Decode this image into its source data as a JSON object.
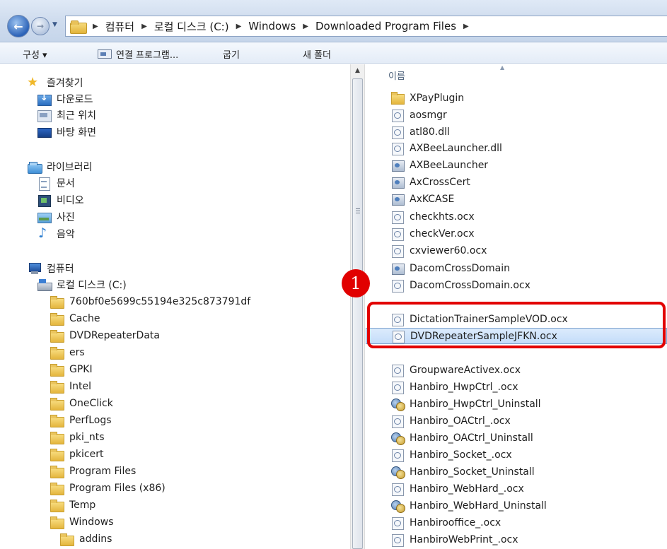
{
  "address_bar": {
    "breadcrumbs": [
      "컴퓨터",
      "로컬 디스크 (C:)",
      "Windows",
      "Downloaded Program Files"
    ]
  },
  "command_bar": {
    "organize": "구성 ▾",
    "open_with": "연결 프로그램...",
    "burn": "굽기",
    "new_folder": "새 폴더"
  },
  "nav": {
    "favorites": {
      "title": "즐겨찾기",
      "items": [
        "다운로드",
        "최근 위치",
        "바탕 화면"
      ]
    },
    "libraries": {
      "title": "라이브러리",
      "items": [
        "문서",
        "비디오",
        "사진",
        "음악"
      ]
    },
    "computer": {
      "title": "컴퓨터",
      "disk": "로컬 디스크 (C:)",
      "folders": [
        "760bf0e5699c55194e325c873791df",
        "Cache",
        "DVDRepeaterData",
        "ers",
        "GPKI",
        "Intel",
        "OneClick",
        "PerfLogs",
        "pki_nts",
        "pkicert",
        "Program Files",
        "Program Files (x86)",
        "Temp",
        "Windows"
      ],
      "subfolder": "addins"
    }
  },
  "file_list": {
    "column_name": "이름",
    "files": [
      {
        "name": "XPayPlugin",
        "icon": "folder-icon"
      },
      {
        "name": "aosmgr",
        "icon": "ocx-file-icon"
      },
      {
        "name": "atl80.dll",
        "icon": "ocx-file-icon"
      },
      {
        "name": "AXBeeLauncher.dll",
        "icon": "ocx-file-icon"
      },
      {
        "name": "AXBeeLauncher",
        "icon": "app-icon"
      },
      {
        "name": "AxCrossCert",
        "icon": "app-icon"
      },
      {
        "name": "AxKCASE",
        "icon": "app-icon"
      },
      {
        "name": "checkhts.ocx",
        "icon": "ocx-file-icon"
      },
      {
        "name": "checkVer.ocx",
        "icon": "ocx-file-icon"
      },
      {
        "name": "cxviewer60.ocx",
        "icon": "ocx-file-icon"
      },
      {
        "name": "DacomCrossDomain",
        "icon": "app-icon"
      },
      {
        "name": "DacomCrossDomain.ocx",
        "icon": "ocx-file-icon"
      },
      {
        "name": "DictationTrainerSampleVOD.ocx",
        "icon": "ocx-file-icon"
      },
      {
        "name": "DVDRepeaterSampleJFKN.ocx",
        "icon": "ocx-file-icon",
        "selected": true
      },
      {
        "name": "GroupwareActivex.ocx",
        "icon": "ocx-file-icon"
      },
      {
        "name": "Hanbiro_HwpCtrl_.ocx",
        "icon": "ocx-file-icon"
      },
      {
        "name": "Hanbiro_HwpCtrl_Uninstall",
        "icon": "uninstall-icon"
      },
      {
        "name": "Hanbiro_OACtrl_.ocx",
        "icon": "ocx-file-icon"
      },
      {
        "name": "Hanbiro_OACtrl_Uninstall",
        "icon": "uninstall-icon"
      },
      {
        "name": "Hanbiro_Socket_.ocx",
        "icon": "ocx-file-icon"
      },
      {
        "name": "Hanbiro_Socket_Uninstall",
        "icon": "uninstall-icon"
      },
      {
        "name": "Hanbiro_WebHard_.ocx",
        "icon": "ocx-file-icon"
      },
      {
        "name": "Hanbiro_WebHard_Uninstall",
        "icon": "uninstall-icon"
      },
      {
        "name": "Hanbirooffice_.ocx",
        "icon": "ocx-file-icon"
      },
      {
        "name": "HanbiroWebPrint_.ocx",
        "icon": "ocx-file-icon"
      }
    ]
  },
  "annotation": {
    "badge": "1",
    "color": "#e20000"
  }
}
